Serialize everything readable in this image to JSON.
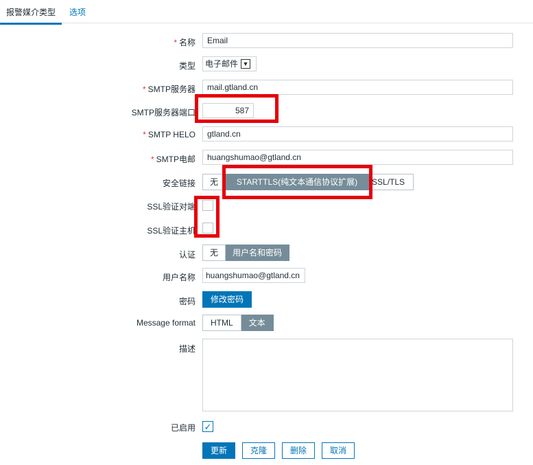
{
  "tabs": [
    {
      "label": "报警媒介类型"
    },
    {
      "label": "选项"
    }
  ],
  "form": {
    "name": {
      "label": "名称",
      "value": "Email"
    },
    "type": {
      "label": "类型",
      "value": "电子邮件",
      "arrow_icon": "chevron-down-icon"
    },
    "smtp_server": {
      "label": "SMTP服务器",
      "value": "mail.gtland.cn"
    },
    "smtp_port": {
      "label": "SMTP服务器端口",
      "value": "587"
    },
    "smtp_helo": {
      "label": "SMTP HELO",
      "value": "gtland.cn"
    },
    "smtp_email": {
      "label": "SMTP电邮",
      "value": "huangshumao@gtland.cn"
    },
    "security": {
      "label": "安全链接",
      "options": [
        "无",
        "STARTTLS(纯文本通信协议扩展)",
        "SSL/TLS"
      ],
      "selected": "STARTTLS(纯文本通信协议扩展)"
    },
    "ssl_verify_peer": {
      "label": "SSL验证对端",
      "checked": false
    },
    "ssl_verify_host": {
      "label": "SSL验证主机",
      "checked": false
    },
    "auth": {
      "label": "认证",
      "options": [
        "无",
        "用户名和密码"
      ],
      "selected": "用户名和密码"
    },
    "username": {
      "label": "用户名称",
      "value": "huangshumao@gtland.cn"
    },
    "password": {
      "label": "密码",
      "button": "修改密码"
    },
    "message_format": {
      "label": "Message format",
      "options": [
        "HTML",
        "文本"
      ],
      "selected": "文本"
    },
    "description": {
      "label": "描述",
      "value": ""
    },
    "enabled": {
      "label": "已启用",
      "checked": true,
      "check_icon": "checkmark-icon"
    }
  },
  "actions": {
    "update": "更新",
    "clone": "克隆",
    "delete": "删除",
    "cancel": "取消"
  },
  "colors": {
    "accent": "#0275b8",
    "selected_segment": "#768d99",
    "required": "#e33734",
    "highlight_box": "#e5000b"
  }
}
